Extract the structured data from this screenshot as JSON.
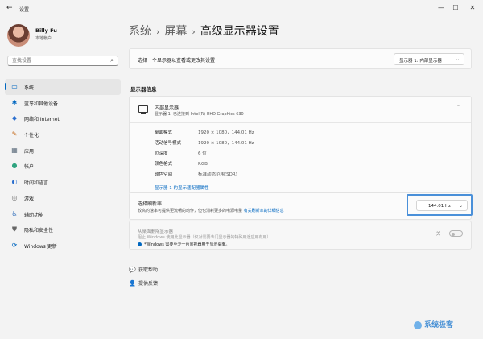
{
  "titlebar": {
    "title": "设置",
    "back_icon": "←",
    "minimize": "—",
    "maximize": "☐",
    "close": "✕"
  },
  "user": {
    "name": "Billy Fu",
    "account_type": "本地帐户"
  },
  "search": {
    "placeholder": "查找设置",
    "icon": "⌕"
  },
  "nav": {
    "items": [
      {
        "label": "系统",
        "icon": "▭",
        "color": "#0067c0"
      },
      {
        "label": "蓝牙和其他设备",
        "icon": "✱",
        "color": "#0067c0"
      },
      {
        "label": "网络和 Internet",
        "icon": "◆",
        "color": "#2b6fcf"
      },
      {
        "label": "个性化",
        "icon": "✎",
        "color": "#c46a1a"
      },
      {
        "label": "应用",
        "icon": "▦",
        "color": "#5a6a7a"
      },
      {
        "label": "帐户",
        "icon": "●",
        "color": "#2fa37f"
      },
      {
        "label": "时间和语言",
        "icon": "◐",
        "color": "#2b6fcf"
      },
      {
        "label": "游戏",
        "icon": "◎",
        "color": "#777"
      },
      {
        "label": "辅助功能",
        "icon": "♿",
        "color": "#1a5fb4"
      },
      {
        "label": "隐私和安全性",
        "icon": "⛊",
        "color": "#666"
      },
      {
        "label": "Windows 更新",
        "icon": "⟳",
        "color": "#0067c0"
      }
    ]
  },
  "breadcrumb": {
    "items": [
      "系统",
      "屏幕",
      "高级显示器设置"
    ],
    "separator": "›"
  },
  "display_select": {
    "label": "选择一个显示器以查看或更改其设置",
    "value": "显示器 1: 内部显示器",
    "chevron": "⌄"
  },
  "section_title": "显示器信息",
  "monitor": {
    "name": "内部显示器",
    "subtitle": "显示器 1: 已连接到 Intel(R) UHD Graphics 630",
    "chevron": "⌃",
    "specs": [
      {
        "label": "桌面模式",
        "value": "1920 × 1080，144.01 Hz"
      },
      {
        "label": "活动信号模式",
        "value": "1920 × 1080，144.01 Hz"
      },
      {
        "label": "位深度",
        "value": "6 位"
      },
      {
        "label": "颜色格式",
        "value": "RGB"
      },
      {
        "label": "颜色空间",
        "value": "标准动态范围(SDR)"
      }
    ],
    "adapter_link": "显示器 1 的显示适配器属性"
  },
  "refresh_rate": {
    "title": "选择刷新率",
    "desc": "较高的速率可提供更流畅的动作，但也消耗更多的电源电量",
    "link": "有关刷新率的详细信息",
    "value": "144.01 Hz",
    "chevron": "⌄"
  },
  "remove_display": {
    "title": "从桌面删除显示器",
    "desc": "阻止 Windows 使用此显示器（仅对需要专门显示器的特殊用途应用有用）",
    "info": "*Windows 需要至少一台监视器用于显示桌面。",
    "toggle_label": "关",
    "toggle_on": false
  },
  "help": {
    "get_help": "获取帮助",
    "feedback": "提供反馈"
  },
  "watermark": "系统极客"
}
